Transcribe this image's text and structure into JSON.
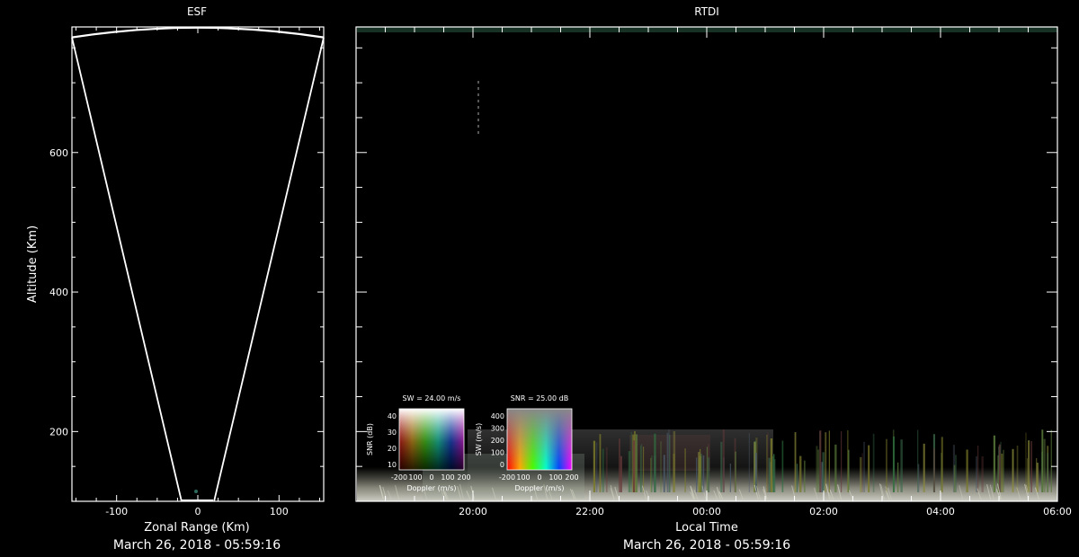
{
  "chart_data": [
    {
      "type": "line",
      "title": "ESF",
      "xlabel": "Zonal Range (Km)",
      "ylabel": "Altitude (Km)",
      "xlim": [
        -155,
        155
      ],
      "ylim": [
        100,
        780
      ],
      "xticks": [
        -100,
        0,
        100
      ],
      "xtick_labels": [
        "-100",
        "0",
        "100"
      ],
      "yticks": [
        200,
        400,
        600
      ],
      "ytick_labels": [
        "200",
        "400",
        "600"
      ],
      "date": "March 26, 2018 - 05:59:16",
      "series": [
        {
          "points": [
            [
              -20,
              100
            ],
            [
              -155,
              765
            ]
          ]
        },
        {
          "points": [
            [
              20,
              100
            ],
            [
              155,
              765
            ]
          ]
        }
      ]
    },
    {
      "type": "heatmap",
      "title": "RTDI",
      "xlabel": "Local Time",
      "ylabel": "",
      "xlim": [
        18.0,
        30.0
      ],
      "ylim": [
        100,
        780
      ],
      "xticks": [
        20,
        22,
        24,
        26,
        28,
        30
      ],
      "xtick_labels": [
        "20:00",
        "22:00",
        "00:00",
        "02:00",
        "04:00",
        "06:00"
      ],
      "date": "March 26, 2018 - 05:59:16",
      "legend_boxes": [
        {
          "title": "SW = 24.00 m/s",
          "ylabel": "SNR (dB)",
          "xlabel": "Doppler (m/s)",
          "yticks": [
            "40",
            "30",
            "20",
            "10"
          ],
          "xticks": [
            "-200",
            "100",
            "0",
            "100",
            "200"
          ]
        },
        {
          "title": "SNR = 25.00 dB",
          "ylabel": "SW (m/s)",
          "xlabel": "Doppler (m/s)",
          "yticks": [
            "400",
            "300",
            "200",
            "100",
            "0"
          ],
          "xticks": [
            "-200",
            "100",
            "0",
            "100",
            "200"
          ]
        }
      ]
    }
  ]
}
